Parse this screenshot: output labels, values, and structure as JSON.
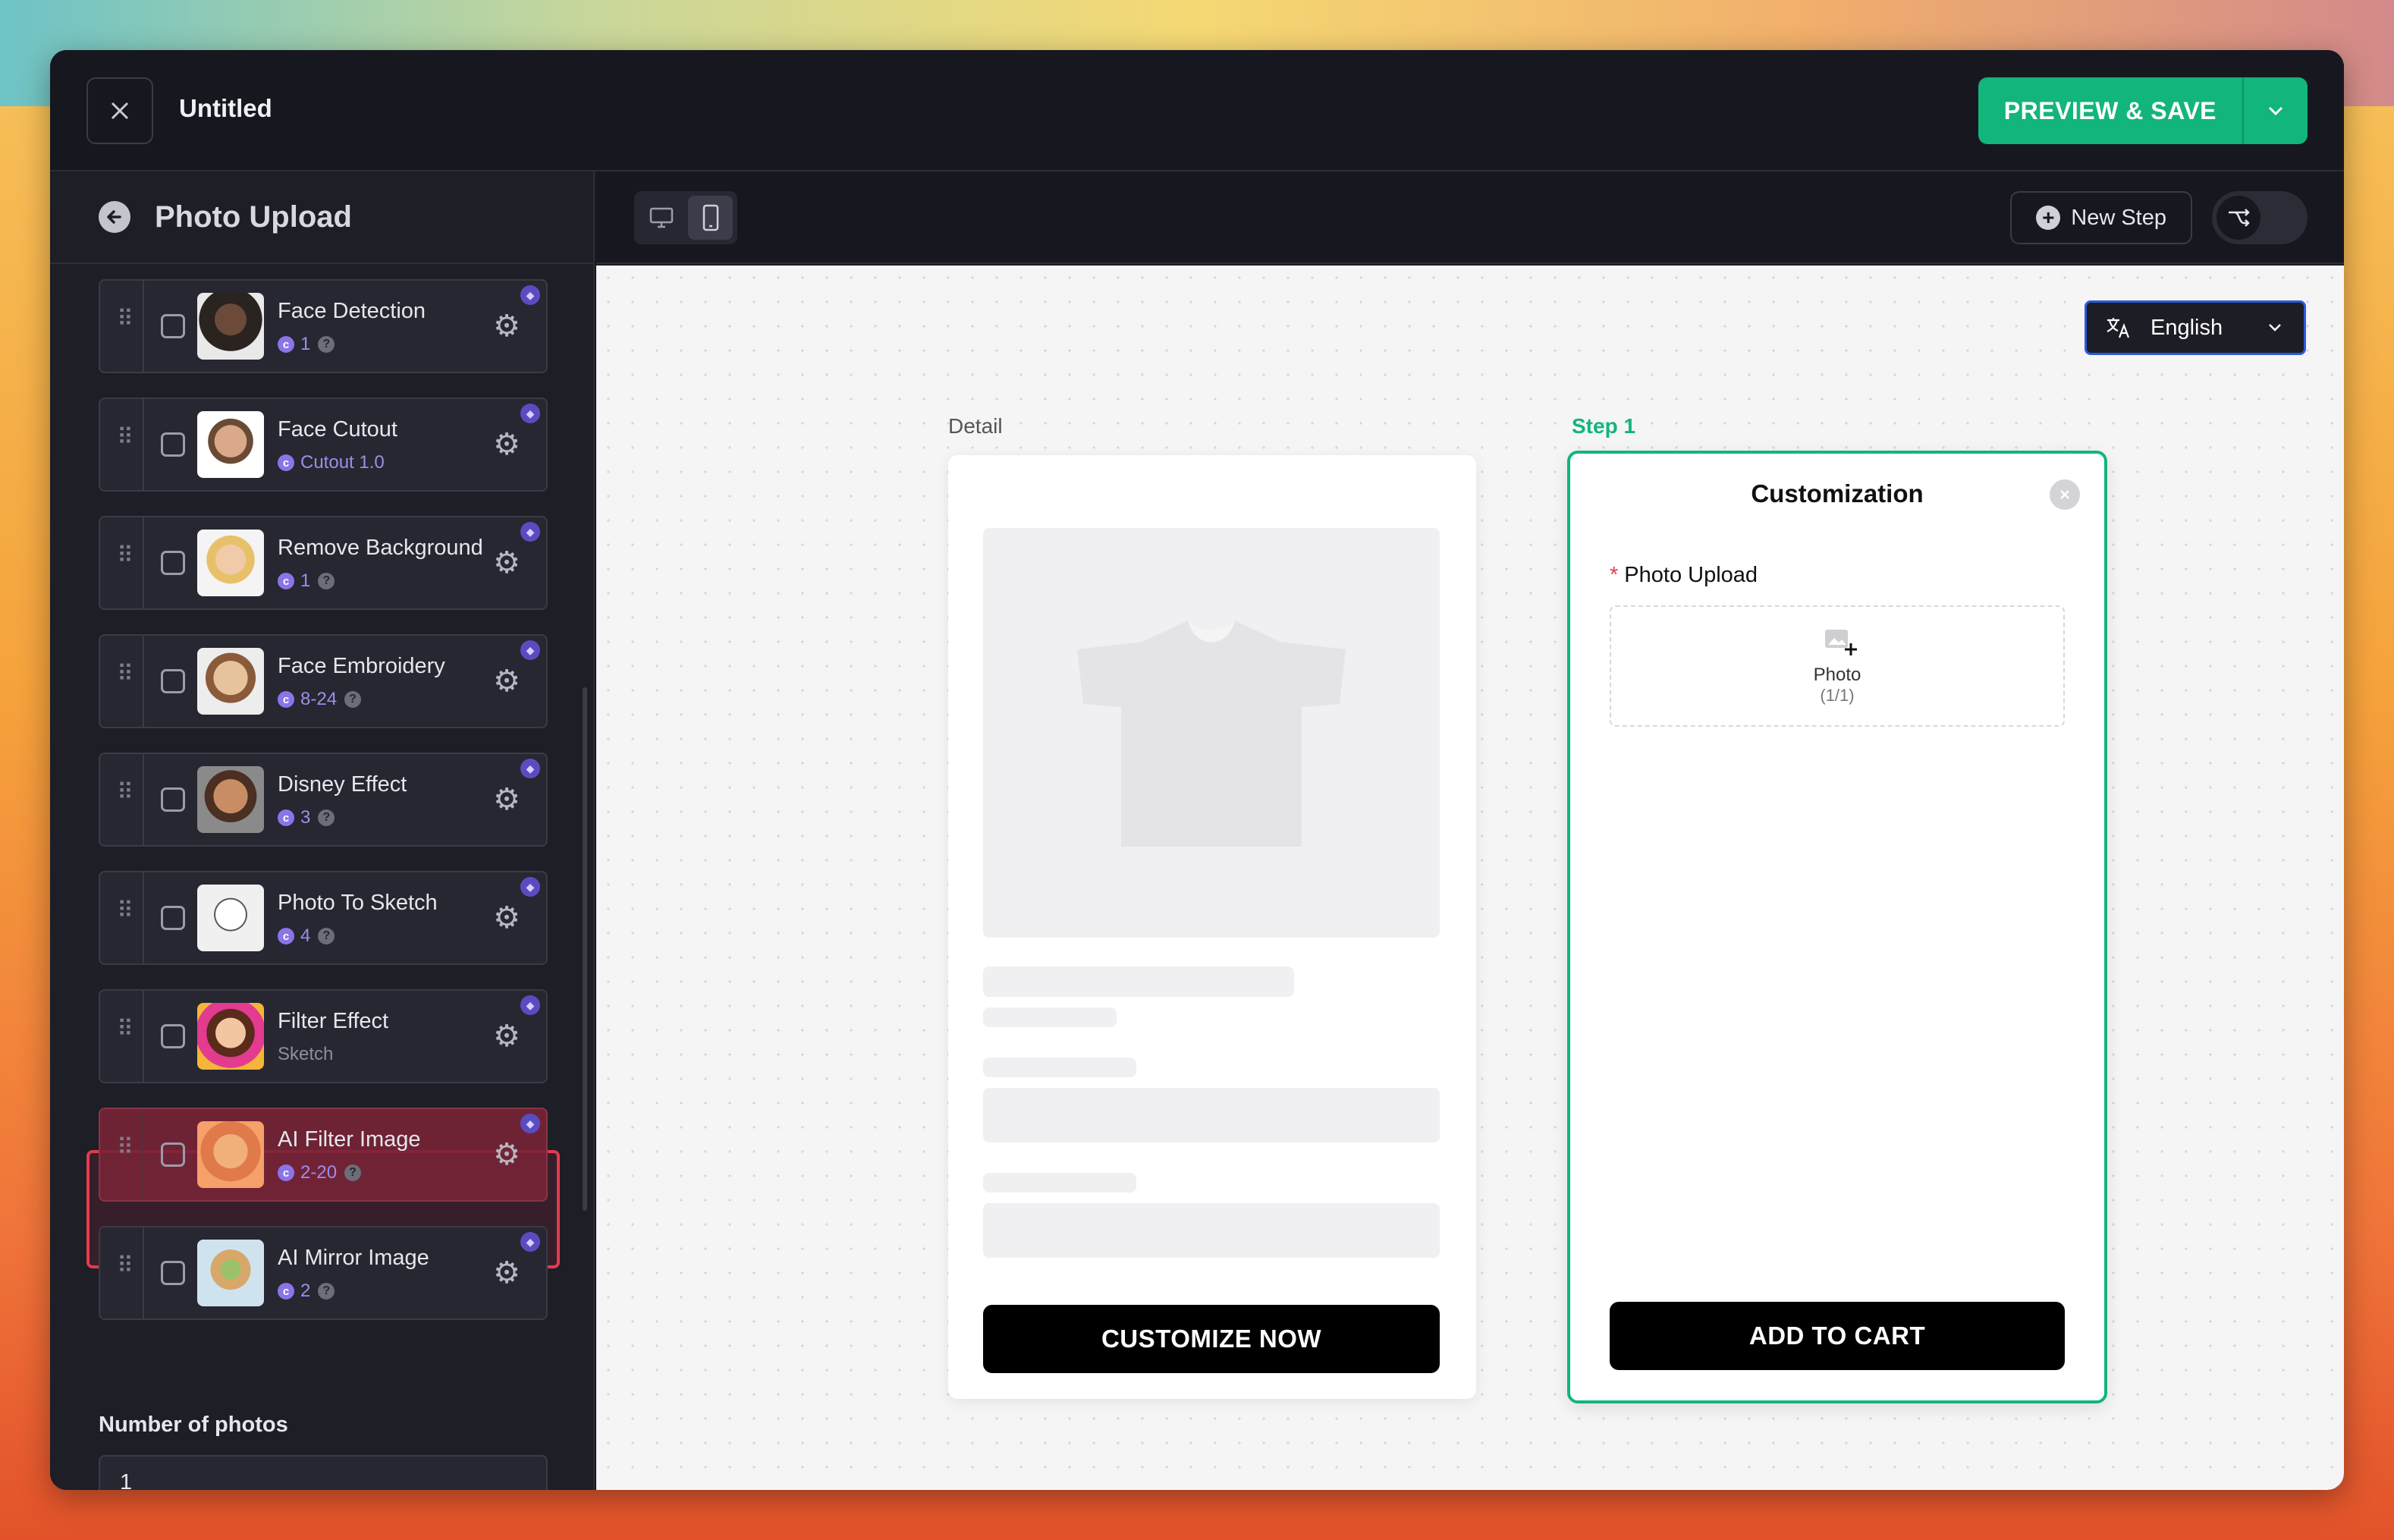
{
  "app": {
    "title": "Untitled",
    "save_label": "PREVIEW & SAVE"
  },
  "sidebar": {
    "title": "Photo Upload",
    "items": [
      {
        "name": "Face Detection",
        "meta": "1",
        "help": true,
        "purple": true
      },
      {
        "name": "Face Cutout",
        "meta": "Cutout 1.0",
        "help": false,
        "purple": true
      },
      {
        "name": "Remove Background",
        "meta": "1",
        "help": true,
        "purple": true
      },
      {
        "name": "Face Embroidery",
        "meta": "8-24",
        "help": true,
        "purple": true
      },
      {
        "name": "Disney Effect",
        "meta": "3",
        "help": true,
        "purple": true
      },
      {
        "name": "Photo To Sketch",
        "meta": "4",
        "help": true,
        "purple": true
      },
      {
        "name": "Filter Effect",
        "meta": "Sketch",
        "help": false,
        "purple": false
      },
      {
        "name": "AI Filter Image",
        "meta": "2-20",
        "help": true,
        "purple": true
      },
      {
        "name": "AI Mirror Image",
        "meta": "2",
        "help": true,
        "purple": true
      }
    ],
    "number_label": "Number of photos",
    "number_value": "1"
  },
  "canvas_header": {
    "new_step_label": "New Step"
  },
  "canvas": {
    "language": "English",
    "detail_label": "Detail",
    "step_label": "Step 1",
    "detail_button": "CUSTOMIZE NOW",
    "step": {
      "title": "Customization",
      "field_label": "Photo Upload",
      "required_mark": "*",
      "upload_label": "Photo",
      "upload_count": "(1/1)",
      "button": "ADD TO CART"
    }
  },
  "colors": {
    "accent_green": "#12b57a",
    "highlight_red": "#e23b4f",
    "language_border": "#2a5bd8"
  }
}
